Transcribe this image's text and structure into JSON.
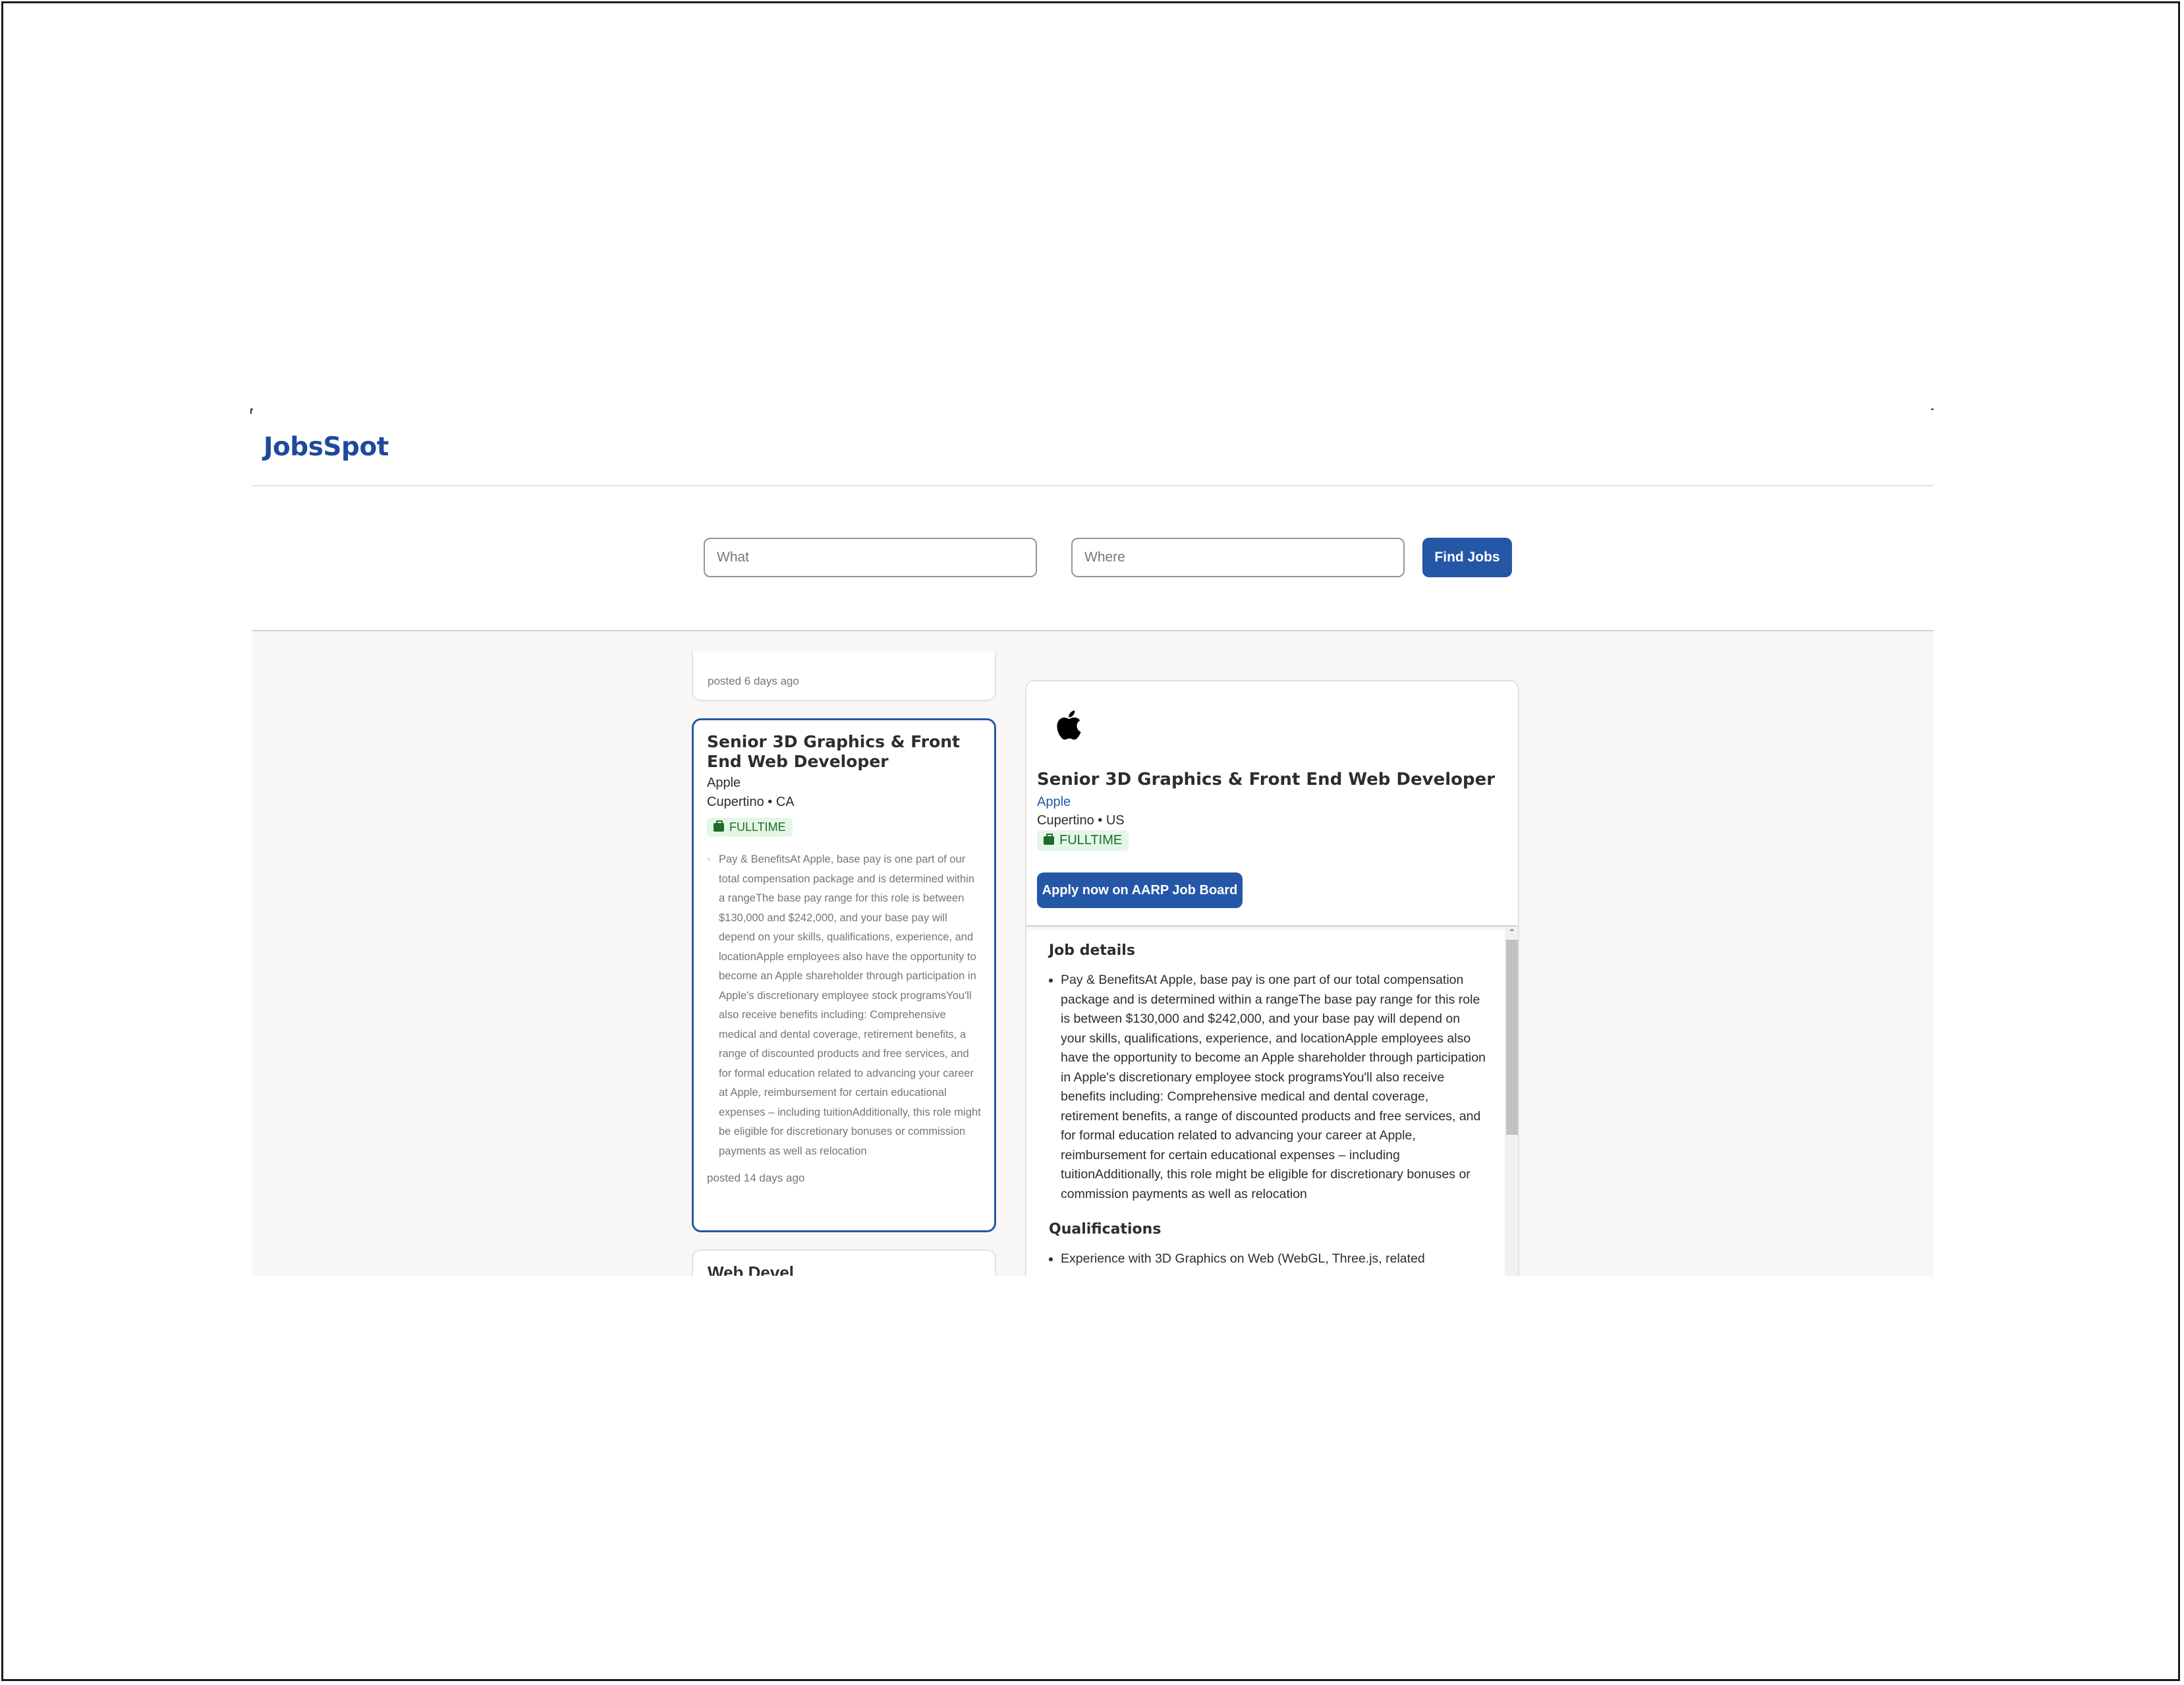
{
  "app": {
    "logo": "JobsSpot"
  },
  "search": {
    "what_placeholder": "What",
    "what_value": "",
    "where_placeholder": "Where",
    "where_value": "",
    "button_label": "Find Jobs"
  },
  "list": {
    "previous_card": {
      "posted": "posted 6 days ago"
    },
    "active_card": {
      "title": "Senior 3D Graphics & Front End Web Developer",
      "company": "Apple",
      "location": "Cupertino • CA",
      "job_type": "FULLTIME",
      "snippet": "Pay & BenefitsAt Apple, base pay is one part of our total compensation package and is determined within a rangeThe base pay range for this role is between $130,000 and $242,000, and your base pay will depend on your skills, qualifications, experience, and locationApple employees also have the opportunity to become an Apple shareholder through participation in Apple's discretionary employee stock programsYou'll also receive benefits including: Comprehensive medical and dental coverage, retirement benefits, a range of discounted products and free services, and for formal education related to advancing your career at Apple, reimbursement for certain educational expenses – including tuitionAdditionally, this role might be eligible for discretionary bonuses or commission payments as well as relocation",
      "posted": "posted 14 days ago"
    },
    "next_card": {
      "title_partial": "Web Devel"
    }
  },
  "detail": {
    "logo_icon": "apple-logo-icon",
    "title": "Senior 3D Graphics & Front End Web Developer",
    "company": "Apple",
    "location": "Cupertino • US",
    "job_type": "FULLTIME",
    "apply_label": "Apply now on AARP Job Board",
    "sections": {
      "job_details_heading": "Job details",
      "job_details_item": "Pay & BenefitsAt Apple, base pay is one part of our total compensation package and is determined within a rangeThe base pay range for this role is between $130,000 and $242,000, and your base pay will depend on your skills, qualifications, experience, and locationApple employees also have the opportunity to become an Apple shareholder through participation in Apple's discretionary employee stock programsYou'll also receive benefits including: Comprehensive medical and dental coverage, retirement benefits, a range of discounted products and free services, and for formal education related to advancing your career at Apple, reimbursement for certain educational expenses – including tuitionAdditionally, this role might be eligible for discretionary bonuses or commission payments as well as relocation",
      "qualifications_heading": "Qualifications",
      "qualifications_item": "Experience with 3D Graphics on Web (WebGL, Three.js, related"
    }
  },
  "colors": {
    "brand": "#1d4a9c",
    "primary_button": "#2557a7",
    "badge_bg": "#e4f7e6",
    "badge_text": "#1e6b2b",
    "content_bg": "#f8f7f5"
  }
}
